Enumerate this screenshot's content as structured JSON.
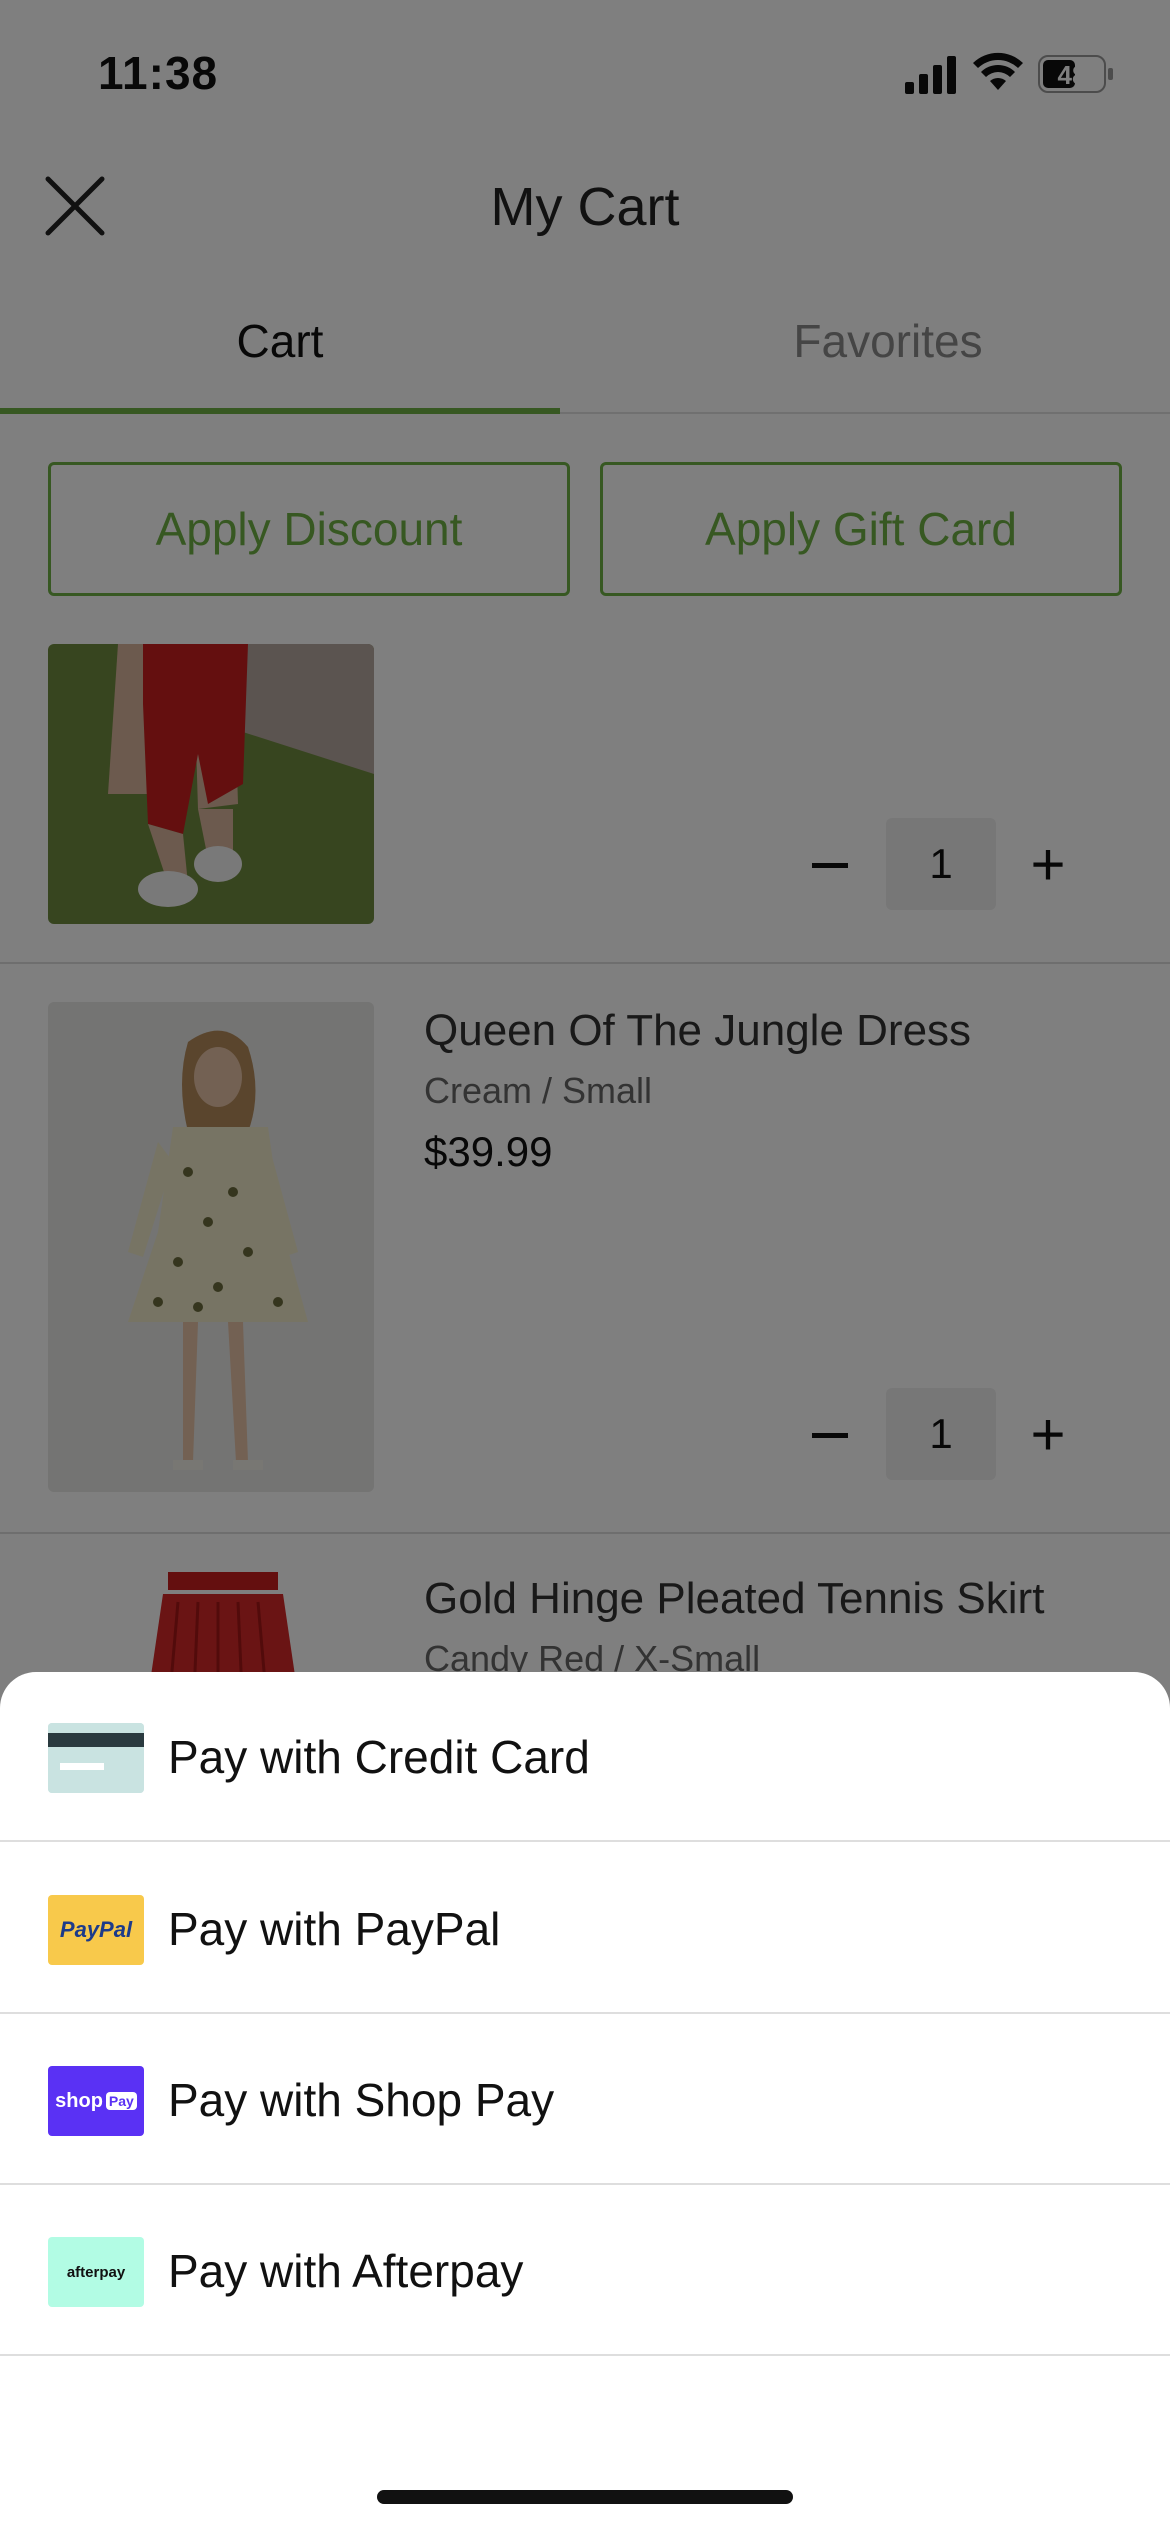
{
  "status": {
    "time": "11:38",
    "battery": "48"
  },
  "header": {
    "title": "My Cart"
  },
  "tabs": [
    {
      "label": "Cart",
      "active": true
    },
    {
      "label": "Favorites",
      "active": false
    }
  ],
  "promo": {
    "discount_label": "Apply Discount",
    "gift_label": "Apply Gift Card"
  },
  "items": [
    {
      "name": "",
      "variant": "",
      "price": "",
      "quantity": "1"
    },
    {
      "name": "Queen Of The Jungle Dress",
      "variant": "Cream / Small",
      "price": "$39.99",
      "quantity": "1"
    },
    {
      "name": "Gold Hinge Pleated Tennis Skirt",
      "variant": "Candy Red / X-Small"
    }
  ],
  "payment_options": [
    {
      "label": "Pay with Credit Card",
      "icon": "credit-card-icon"
    },
    {
      "label": "Pay with PayPal",
      "icon": "paypal-logo",
      "logo_text": "PayPal"
    },
    {
      "label": "Pay with Shop Pay",
      "icon": "shop-pay-logo",
      "logo_text": "shop",
      "logo_badge": "Pay"
    },
    {
      "label": "Pay with Afterpay",
      "icon": "afterpay-logo",
      "logo_text": "afterpay"
    }
  ],
  "colors": {
    "accent": "#6fb045",
    "paypal_bg": "#f8c94b",
    "shoppay_bg": "#5a31f4",
    "afterpay_bg": "#b2fce4"
  }
}
